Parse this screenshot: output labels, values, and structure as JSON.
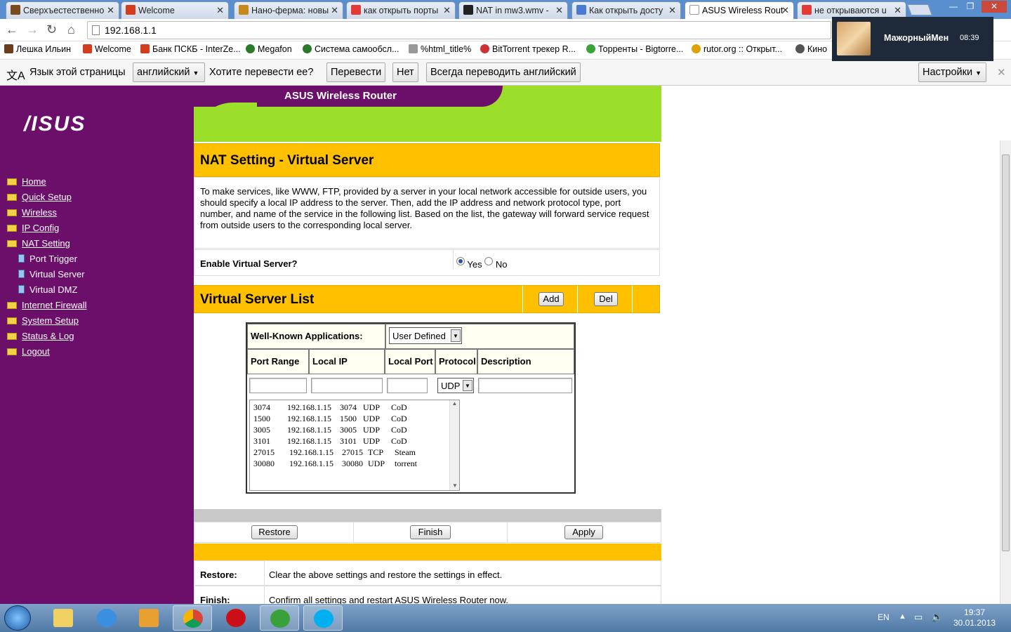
{
  "browser": {
    "tabs": [
      {
        "label": "Сверхъестественно",
        "color": "#7a4a1e"
      },
      {
        "label": "Welcome",
        "color": "#d33c1c"
      },
      {
        "label": "Нано-ферма: новы",
        "color": "#c78a1a"
      },
      {
        "label": "как открыть порты",
        "color": "#e53935"
      },
      {
        "label": "NAT in mw3.wmv -",
        "color": "#222222"
      },
      {
        "label": "Как открыть досту",
        "color": "#4a7bd1"
      },
      {
        "label": "ASUS Wireless Rout",
        "color": "#dddddd"
      },
      {
        "label": "не открываются u",
        "color": "#e53935"
      }
    ],
    "window_controls": {
      "minimize": "—",
      "maximize": "❐",
      "close": "✕"
    },
    "address": "192.168.1.1",
    "bookmarks": [
      {
        "label": "Лешка Ильин",
        "color": "#6b3d1a"
      },
      {
        "label": "Welcome",
        "color": "#d33c1c"
      },
      {
        "label": "Банк ПСКБ - InterZe...",
        "color": "#d33c1c"
      },
      {
        "label": "Megafon",
        "color": "#2a7a2a"
      },
      {
        "label": "Система самообсл...",
        "color": "#2a7a2a"
      },
      {
        "label": "%html_title%",
        "color": "#999999"
      },
      {
        "label": "BitTorrent трекер R...",
        "color": "#cc3333"
      },
      {
        "label": "Торренты - Bigtorre...",
        "color": "#3aa33a"
      },
      {
        "label": "rutor.org :: Открыт...",
        "color": "#e0a000"
      },
      {
        "label": "Кино",
        "color": "#555555"
      }
    ],
    "translate_bar": {
      "lang_prompt": "Язык этой страницы",
      "language": "английский",
      "question": "Хотите перевести ее?",
      "translate_btn": "Перевести",
      "no_btn": "Нет",
      "always_btn": "Всегда переводить английский",
      "settings_btn": "Настройки"
    },
    "notification": {
      "name": "МажорныйМен",
      "time": "08:39"
    }
  },
  "router": {
    "logo": "/ISUS",
    "header_title": "ASUS Wireless Router",
    "menu": [
      {
        "label": "Home"
      },
      {
        "label": "Quick Setup"
      },
      {
        "label": "Wireless"
      },
      {
        "label": "IP Config"
      },
      {
        "label": "NAT Setting"
      }
    ],
    "submenu": [
      {
        "label": "Port Trigger"
      },
      {
        "label": "Virtual Server"
      },
      {
        "label": "Virtual DMZ"
      }
    ],
    "menu_after": [
      {
        "label": "Internet Firewall"
      },
      {
        "label": "System Setup"
      },
      {
        "label": "Status & Log"
      },
      {
        "label": "Logout"
      }
    ],
    "section_title": "NAT Setting - Virtual Server",
    "intro": "To make services, like WWW, FTP, provided by a server in your local network accessible for outside users, you should specify a local IP address to the server. Then, add the IP address and network protocol type, port number, and name of the service in the following list. Based on the list, the gateway will forward service request from outside users to the corresponding local server.",
    "enable_label": "Enable Virtual Server?",
    "enable_yes": "Yes",
    "enable_no": "No",
    "enable_value": "Yes",
    "list_title": "Virtual Server List",
    "add_btn": "Add",
    "del_btn": "Del",
    "well_known_label": "Well-Known Applications:",
    "well_known_value": "User Defined",
    "columns": [
      "Port Range",
      "Local IP",
      "Local Port",
      "Protocol",
      "Description"
    ],
    "protocol_value": "UDP",
    "rows": [
      {
        "port_range": "3074",
        "local_ip": "192.168.1.15",
        "local_port": "3074",
        "protocol": "UDP",
        "description": "CoD"
      },
      {
        "port_range": "1500",
        "local_ip": "192.168.1.15",
        "local_port": "1500",
        "protocol": "UDP",
        "description": "CoD"
      },
      {
        "port_range": "3005",
        "local_ip": "192.168.1.15",
        "local_port": "3005",
        "protocol": "UDP",
        "description": "CoD"
      },
      {
        "port_range": "3101",
        "local_ip": "192.168.1.15",
        "local_port": "3101",
        "protocol": "UDP",
        "description": "CoD"
      },
      {
        "port_range": "27015",
        "local_ip": "192.168.1.15",
        "local_port": "27015",
        "protocol": "TCP",
        "description": "Steam"
      },
      {
        "port_range": "30080",
        "local_ip": "192.168.1.15",
        "local_port": "30080",
        "protocol": "UDP",
        "description": "torrent"
      }
    ],
    "restore_btn": "Restore",
    "finish_btn": "Finish",
    "apply_btn": "Apply",
    "help": [
      {
        "label": "Restore:",
        "text": "Clear the above settings and restore the settings in effect."
      },
      {
        "label": "Finish:",
        "text": "Confirm all settings and restart ASUS Wireless Router now."
      }
    ]
  },
  "taskbar": {
    "lang": "EN",
    "time": "19:37",
    "date": "30.01.2013"
  },
  "colors": {
    "sidebar": "#6b0f6b",
    "header_green": "#9bdf2a",
    "orange": "#ffc000"
  }
}
